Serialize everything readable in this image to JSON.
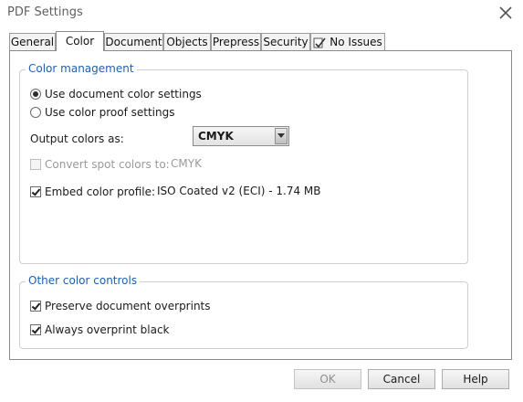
{
  "window": {
    "title": "PDF Settings",
    "close_icon": "close-icon"
  },
  "tabs": [
    {
      "label": "General",
      "active": false
    },
    {
      "label": "Color",
      "active": true
    },
    {
      "label": "Document",
      "active": false
    },
    {
      "label": "Objects",
      "active": false
    },
    {
      "label": "Prepress",
      "active": false
    },
    {
      "label": "Security",
      "active": false
    },
    {
      "label": "No Issues",
      "active": false,
      "icon": "issues-check-icon"
    }
  ],
  "color_management": {
    "legend": "Color management",
    "radio_document": {
      "label": "Use document color settings",
      "selected": true
    },
    "radio_proof": {
      "label": "Use color proof settings",
      "selected": false
    },
    "output_label": "Output colors as:",
    "output_value": "CMYK",
    "convert_spot": {
      "label": "Convert spot colors to:",
      "checked": false,
      "enabled": false,
      "value": "CMYK"
    },
    "embed_profile": {
      "label": "Embed color profile:",
      "checked": true,
      "value": "ISO Coated v2 (ECI) - 1.74 MB"
    }
  },
  "other_controls": {
    "legend": "Other color controls",
    "preserve_overprints": {
      "label": "Preserve document overprints",
      "checked": true
    },
    "overprint_black": {
      "label": "Always overprint black",
      "checked": true
    }
  },
  "buttons": {
    "ok": "OK",
    "cancel": "Cancel",
    "help": "Help"
  },
  "colors": {
    "legend_text": "#1f5fb0",
    "panel_border": "#8a8a8a"
  }
}
